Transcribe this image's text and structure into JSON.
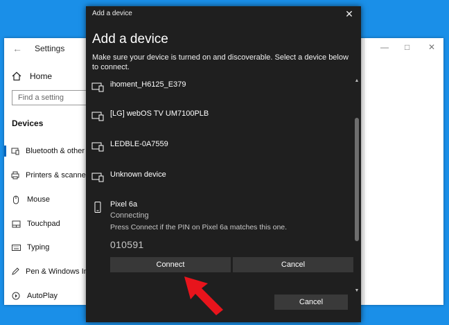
{
  "settings": {
    "title": "Settings",
    "home_label": "Home",
    "search_placeholder": "Find a setting",
    "section": "Devices",
    "nav": [
      {
        "label": "Bluetooth & other devices",
        "icon": "bluetooth-devices-icon",
        "selected": true
      },
      {
        "label": "Printers & scanners",
        "icon": "printer-icon"
      },
      {
        "label": "Mouse",
        "icon": "mouse-icon"
      },
      {
        "label": "Touchpad",
        "icon": "touchpad-icon"
      },
      {
        "label": "Typing",
        "icon": "keyboard-icon"
      },
      {
        "label": "Pen & Windows Ink",
        "icon": "pen-icon"
      },
      {
        "label": "AutoPlay",
        "icon": "autoplay-icon"
      }
    ]
  },
  "dialog": {
    "titlebar": "Add a device",
    "heading": "Add a device",
    "description": "Make sure your device is turned on and discoverable. Select a device below to connect.",
    "devices": [
      {
        "name": "ihoment_H6125_E379",
        "icon": "display-icon"
      },
      {
        "name": "[LG] webOS TV UM7100PLB",
        "icon": "display-icon"
      },
      {
        "name": "LEDBLE-0A7559",
        "icon": "display-icon"
      },
      {
        "name": "Unknown device",
        "icon": "display-icon"
      },
      {
        "name": "Pixel 6a",
        "status": "Connecting",
        "icon": "phone-icon"
      }
    ],
    "pin_prompt": "Press Connect if the PIN on Pixel 6a matches this one.",
    "pin": "010591",
    "connect_label": "Connect",
    "inline_cancel_label": "Cancel",
    "cancel_label": "Cancel"
  },
  "colors": {
    "desktop": "#1a8fe8",
    "dialog_bg": "#1f1f1f",
    "button_bg": "#383838",
    "accent": "#0067c0",
    "arrow": "#e8141c"
  }
}
